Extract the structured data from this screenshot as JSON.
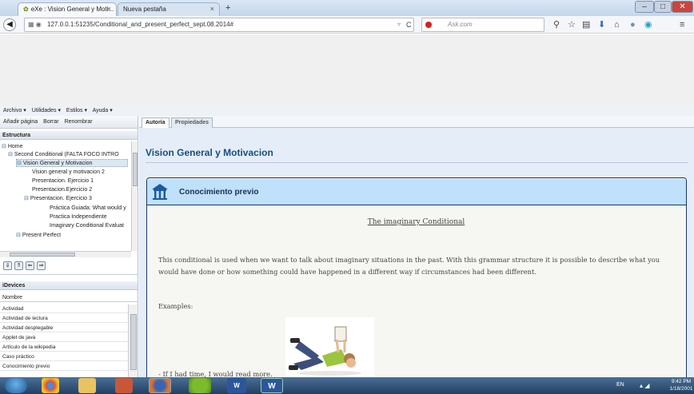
{
  "browser": {
    "tabs": [
      {
        "label": "eXe : Vision General y Moti...",
        "close": "×"
      },
      {
        "label": "Nueva pestaña",
        "close": "×"
      }
    ],
    "new_tab": "+",
    "url": "127.0.0.1:51235/Conditional_and_present_perfect_sept.08.2014#",
    "search_placeholder": "Ask.com"
  },
  "menubar": [
    "Archivo ▾",
    "Utilidades ▾",
    "Estilos ▾",
    "Ayuda ▾"
  ],
  "outline": {
    "actions": [
      "Añadir página",
      "Borrar",
      "Renombrar"
    ],
    "header": "Estructura",
    "nodes": [
      {
        "label": "Home"
      },
      {
        "label": "Second Conditional (FALTA FOCO INTRO"
      },
      {
        "label": "Vision General y Motivacion"
      },
      {
        "label": "Vision general y motivacion 2"
      },
      {
        "label": "Presentacion. Ejercicio 1"
      },
      {
        "label": "Presentacion.Ejercicio 2"
      },
      {
        "label": "Presentacion. Ejercicio 3"
      },
      {
        "label": "Práctica Guiada: What would y"
      },
      {
        "label": "Practica Independiente"
      },
      {
        "label": "Imaginary Conditional Evaluat"
      },
      {
        "label": "Present Perfect"
      }
    ]
  },
  "idevices": {
    "header": "iDevices",
    "column": "Nombre",
    "items": [
      "Actividad",
      "Actividad de lectura",
      "Actividad desplegable",
      "Applet de java",
      "Artículo de la wikipedia",
      "Caso práctico",
      "Conocimiento previo"
    ]
  },
  "editor": {
    "tabs": [
      "Autoría",
      "Propiedades"
    ],
    "page_title": "Vision General y Motivacion",
    "idevice_title": "Conocimiento previo",
    "heading": "The imaginary Conditional",
    "paragraph": "This conditional is used when we want to talk about imaginary situations in the past. With this grammar structure it is possible to describe what you would have done or how something could have happened in a different way if circumstances had been different.",
    "examples_label": "Examples:",
    "example_1": "- If I had time, I would read more."
  },
  "taskbar": {
    "language": "EN",
    "time": "9:42 PM",
    "date": "1/18/2001"
  },
  "colors": {
    "page_title": "#164f82",
    "idevice_header": "#bfe1fb",
    "content_bg": "#e5edf8"
  }
}
